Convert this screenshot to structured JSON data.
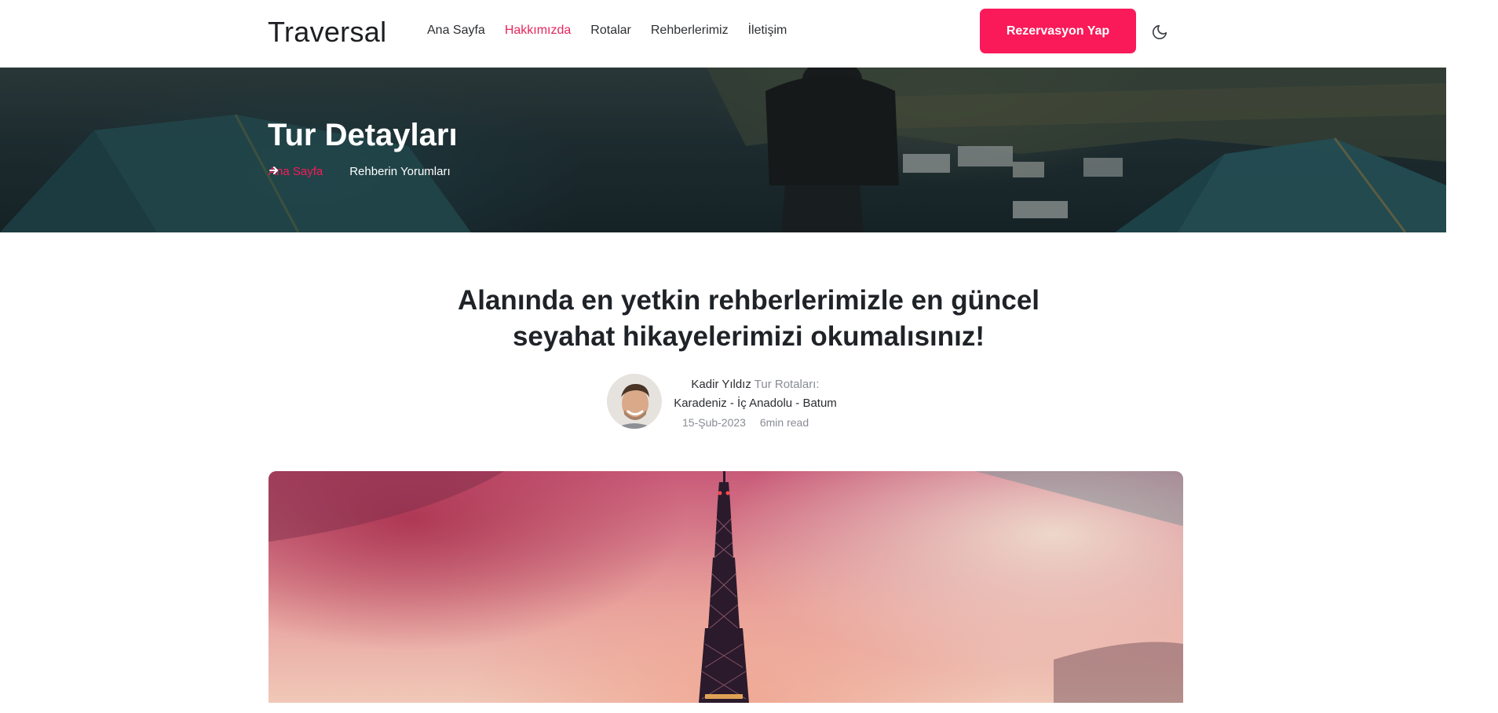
{
  "header": {
    "logo": "Traversal",
    "nav": [
      {
        "label": "Ana Sayfa",
        "active": false
      },
      {
        "label": "Hakkımızda",
        "active": true
      },
      {
        "label": "Rotalar",
        "active": false
      },
      {
        "label": "Rehberlerimiz",
        "active": false
      },
      {
        "label": "İletişim",
        "active": false
      }
    ],
    "cta_label": "Rezervasyon Yap",
    "theme_icon": "moon-icon"
  },
  "hero": {
    "title": "Tur Detayları",
    "breadcrumb": {
      "home": "Ana Sayfa",
      "separator_icon": "arrow-right-icon",
      "current": "Rehberin Yorumları"
    }
  },
  "article": {
    "headline_line1": "Alanında en yetkin rehberlerimizle en güncel",
    "headline_line2": "seyahat hikayelerimizi okumalısınız!",
    "author_name": "Kadir Yıldız",
    "routes_label": "Tur Rotaları:",
    "routes": "Karadeniz - İç Anadolu - Batum",
    "date": "15-Şub-2023",
    "read_time": "6min read"
  },
  "colors": {
    "accent": "#fa1a59",
    "active_nav": "#e6255d",
    "text": "#1f2328",
    "muted": "#888c93"
  }
}
